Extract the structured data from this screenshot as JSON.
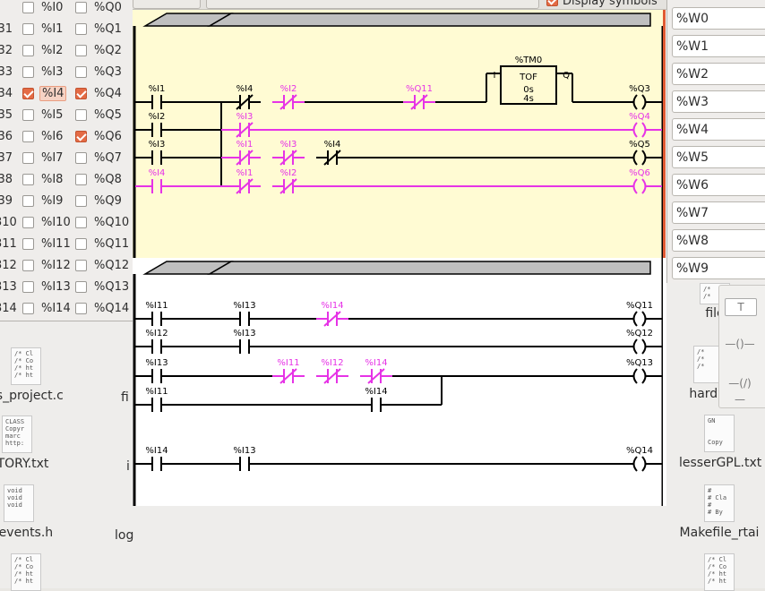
{
  "bits_window": {
    "rows": [
      {
        "num": "",
        "input": "%I0",
        "output": "%Q0",
        "input_checked": false,
        "output_checked": false,
        "highlight": false
      },
      {
        "num": "31",
        "input": "%I1",
        "output": "%Q1",
        "input_checked": false,
        "output_checked": false,
        "highlight": false
      },
      {
        "num": "32",
        "input": "%I2",
        "output": "%Q2",
        "input_checked": false,
        "output_checked": false,
        "highlight": false
      },
      {
        "num": "33",
        "input": "%I3",
        "output": "%Q3",
        "input_checked": false,
        "output_checked": false,
        "highlight": false
      },
      {
        "num": "34",
        "input": "%I4",
        "output": "%Q4",
        "input_checked": true,
        "output_checked": true,
        "highlight": true
      },
      {
        "num": "35",
        "input": "%I5",
        "output": "%Q5",
        "input_checked": false,
        "output_checked": false,
        "highlight": false
      },
      {
        "num": "36",
        "input": "%I6",
        "output": "%Q6",
        "input_checked": false,
        "output_checked": true,
        "highlight": false
      },
      {
        "num": "37",
        "input": "%I7",
        "output": "%Q7",
        "input_checked": false,
        "output_checked": false,
        "highlight": false
      },
      {
        "num": "38",
        "input": "%I8",
        "output": "%Q8",
        "input_checked": false,
        "output_checked": false,
        "highlight": false
      },
      {
        "num": "39",
        "input": "%I9",
        "output": "%Q9",
        "input_checked": false,
        "output_checked": false,
        "highlight": false
      },
      {
        "num": "310",
        "input": "%I10",
        "output": "%Q10",
        "input_checked": false,
        "output_checked": false,
        "highlight": false
      },
      {
        "num": "311",
        "input": "%I11",
        "output": "%Q11",
        "input_checked": false,
        "output_checked": false,
        "highlight": false
      },
      {
        "num": "312",
        "input": "%I12",
        "output": "%Q12",
        "input_checked": false,
        "output_checked": false,
        "highlight": false
      },
      {
        "num": "313",
        "input": "%I13",
        "output": "%Q13",
        "input_checked": false,
        "output_checked": false,
        "highlight": false
      },
      {
        "num": "314",
        "input": "%I14",
        "output": "%Q14",
        "input_checked": false,
        "output_checked": false,
        "highlight": false
      }
    ]
  },
  "ladder": {
    "display_symbols_label": "Display symbols",
    "display_symbols_checked": true,
    "colors": {
      "active": "#e633e6",
      "inactive": "#000000",
      "rung1_bg": "#fffbd3"
    },
    "rung1": {
      "line1": {
        "c1": "%I1",
        "c2": "%I4",
        "c3": "%I2",
        "c4": "%Q11",
        "timer": "%TM0",
        "timer_type": "TOF",
        "timer_in": "I",
        "timer_out": "Q",
        "timer_val": "0s",
        "timer_preset": "4s",
        "coil": "%Q3"
      },
      "line2": {
        "c1": "%I2",
        "c2": "%I3",
        "coil": "%Q4"
      },
      "line3": {
        "c1": "%I3",
        "c2": "%I1",
        "c3": "%I3",
        "c4": "%I4",
        "coil": "%Q5"
      },
      "line4": {
        "c1": "%I4",
        "c2": "%I1",
        "c3": "%I2",
        "coil": "%Q6"
      }
    },
    "rung2": {
      "line1": {
        "c1": "%I11",
        "c2": "%I13",
        "c3": "%I14",
        "coil": "%Q11"
      },
      "line2": {
        "c1": "%I12",
        "c2": "%I13",
        "coil": "%Q12"
      },
      "line3": {
        "c1": "%I13",
        "c2": "%I11",
        "c3": "%I12",
        "c4": "%I14",
        "coil": "%Q13"
      },
      "line4": {
        "c1": "%I11",
        "c2": "%I14"
      },
      "line5": {
        "c1": "%I14",
        "c2": "%I13",
        "coil": "%Q14"
      }
    }
  },
  "words_window": {
    "fields": [
      "%W0",
      "%W1",
      "%W2",
      "%W3",
      "%W4",
      "%W5",
      "%W6",
      "%W7",
      "%W8",
      "%W9"
    ]
  },
  "desktop": {
    "icons_left": [
      {
        "preview": "/* Cl\n/* Co\n/* ht\n/* ht",
        "label": "es_project.c"
      },
      {
        "preview": "CLASS\nCopyr\nmarc\nhttp:",
        "label": "ISTORY.txt"
      },
      {
        "preview": "void\nvoid\nvoid",
        "label": "g_events.h"
      },
      {
        "preview": "/* Cl\n/* Co\n/* ht\n/* ht",
        "label": ""
      }
    ],
    "labels_middle": [
      "fi",
      "i",
      "log"
    ],
    "icons_right": [
      {
        "preview": "/*\n/*",
        "label": "file"
      },
      {
        "preview": "/*\n/*\n/*",
        "label": "hardw"
      },
      {
        "preview": "GN\n\n\nCopy",
        "label": "lesserGPL.txt"
      },
      {
        "preview": "#\n# Cla\n#\n# By",
        "label": "Makefile_rtai"
      },
      {
        "preview": "/* Cl\n/* Co\n/* ht\n/* ht",
        "label": ""
      }
    ]
  },
  "palette": {
    "tools": [
      "T",
      "—()—",
      "—(/)—"
    ]
  }
}
